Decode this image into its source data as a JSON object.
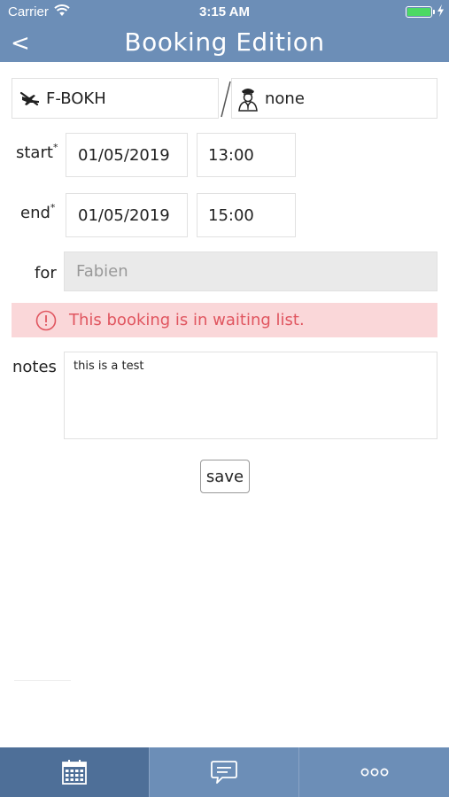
{
  "status_bar": {
    "carrier": "Carrier",
    "time": "3:15 AM",
    "battery_level": 1.0
  },
  "header": {
    "back_icon": "chevron-left-icon",
    "back_label": "<",
    "title": "Booking Edition"
  },
  "aircraft": {
    "icon": "airplane-icon",
    "value": "F-BOKH"
  },
  "pilot": {
    "icon": "pilot-icon",
    "value": "none"
  },
  "start": {
    "label": "start",
    "required_mark": "*",
    "date": "01/05/2019",
    "time": "13:00"
  },
  "end": {
    "label": "end",
    "required_mark": "*",
    "date": "01/05/2019",
    "time": "15:00"
  },
  "for": {
    "label": "for",
    "value": "Fabien"
  },
  "alert": {
    "icon": "exclamation-circle-icon",
    "text": "This booking is in waiting list."
  },
  "notes": {
    "label": "notes",
    "value": "this is a test"
  },
  "actions": {
    "save_label": "save"
  },
  "tabbar": {
    "tabs": [
      {
        "icon": "calendar-icon",
        "selected": true
      },
      {
        "icon": "chat-icon",
        "selected": false
      },
      {
        "icon": "more-icon",
        "selected": false
      }
    ]
  },
  "colors": {
    "header": "#6c8eb7",
    "tab_selected": "#4e6f98",
    "alert_bg": "#fad7d9",
    "alert_text": "#e0555f",
    "disabled_bg": "#eaeaea"
  }
}
